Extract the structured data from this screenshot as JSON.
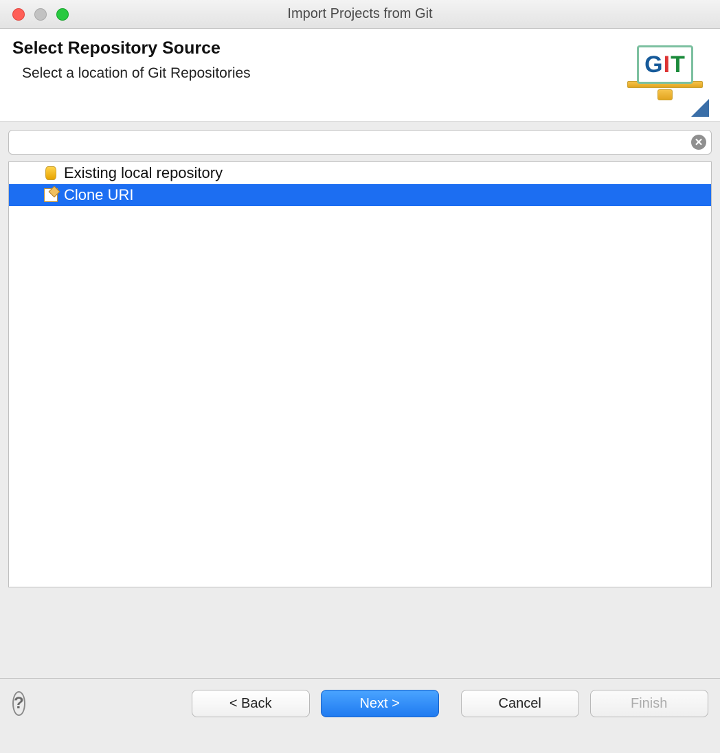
{
  "window": {
    "title": "Import Projects from Git"
  },
  "banner": {
    "heading": "Select Repository Source",
    "subheading": "Select a location of Git Repositories",
    "logo_text": {
      "g": "G",
      "i": "I",
      "t": "T"
    }
  },
  "filter": {
    "value": "",
    "placeholder": ""
  },
  "sources": {
    "items": [
      {
        "label": "Existing local repository",
        "icon": "cylinder-icon",
        "selected": false
      },
      {
        "label": "Clone URI",
        "icon": "paper-edit-icon",
        "selected": true
      }
    ]
  },
  "buttons": {
    "back": "< Back",
    "next": "Next >",
    "cancel": "Cancel",
    "finish": "Finish"
  }
}
